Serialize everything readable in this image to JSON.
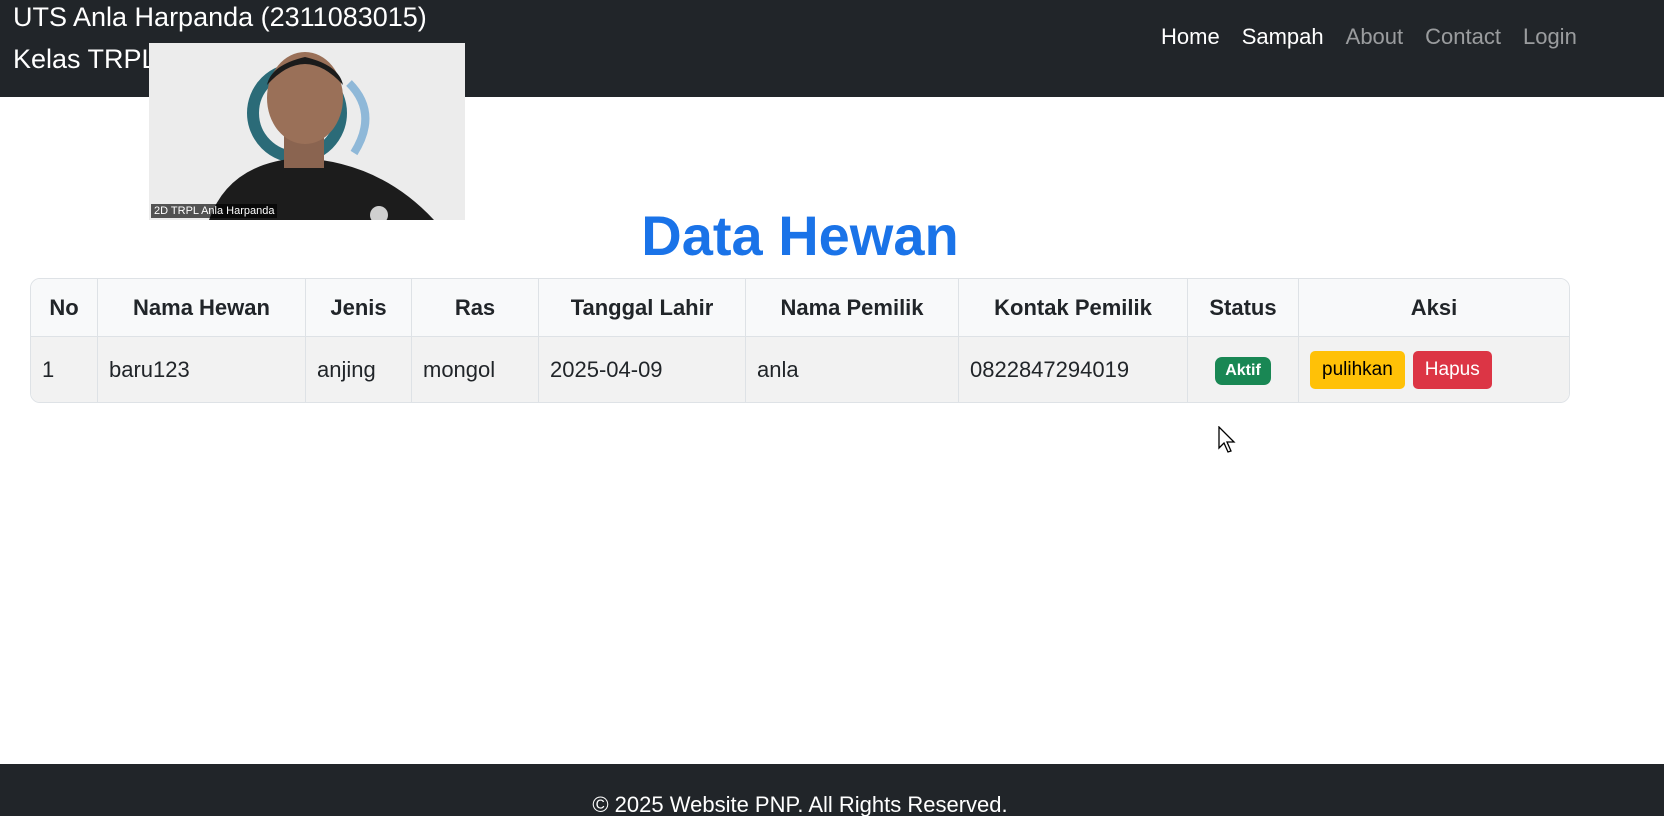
{
  "header": {
    "title_line1": "UTS Anla Harpanda (2311083015)",
    "title_line2": "Kelas TRPL",
    "nav": [
      {
        "label": "Home",
        "active": true
      },
      {
        "label": "Sampah",
        "active": true
      },
      {
        "label": "About",
        "active": false
      },
      {
        "label": "Contact",
        "active": false
      },
      {
        "label": "Login",
        "active": false
      }
    ]
  },
  "webcam": {
    "label": "2D TRPL Anla Harpanda"
  },
  "main": {
    "title": "Data Hewan",
    "table": {
      "columns": [
        "No",
        "Nama Hewan",
        "Jenis",
        "Ras",
        "Tanggal Lahir",
        "Nama Pemilik",
        "Kontak Pemilik",
        "Status",
        "Aksi"
      ],
      "rows": [
        {
          "no": "1",
          "nama_hewan": "baru123",
          "jenis": "anjing",
          "ras": "mongol",
          "tanggal_lahir": "2025-04-09",
          "nama_pemilik": "anla",
          "kontak_pemilik": "0822847294019",
          "status": "Aktif",
          "actions": {
            "restore": "pulihkan",
            "delete": "Hapus"
          }
        }
      ]
    }
  },
  "footer": {
    "text": "© 2025 Website PNP. All Rights Reserved."
  },
  "colors": {
    "navbar": "#212529",
    "title": "#1a73e8",
    "status_active": "#198754",
    "btn_warning": "#ffc107",
    "btn_danger": "#dc3545"
  }
}
